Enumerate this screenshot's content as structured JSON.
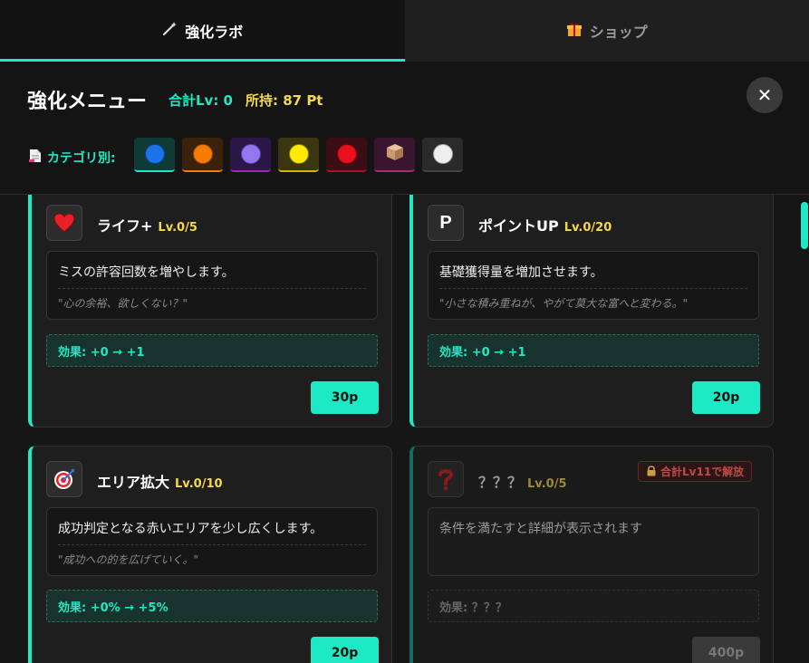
{
  "tabs": [
    {
      "label": "強化ラボ",
      "icon": "wand-icon",
      "active": true
    },
    {
      "label": "ショップ",
      "icon": "gift-icon",
      "active": false
    }
  ],
  "header": {
    "title": "強化メニュー",
    "total_lv": "合計Lv: 0",
    "points": "所持: 87 Pt",
    "close_symbol": "✕"
  },
  "categories": {
    "label": "カテゴリ別:",
    "items": [
      {
        "name": "blue",
        "color": "#1a73e8",
        "bg": "#0e3b36",
        "border": "#1de9c5"
      },
      {
        "name": "orange",
        "color": "#f57c00",
        "bg": "#3a220a",
        "border": "#f57c00"
      },
      {
        "name": "purple",
        "color": "#9575f0",
        "bg": "#2a1647",
        "border": "#9c27b0"
      },
      {
        "name": "yellow",
        "color": "#ffea00",
        "bg": "#3b3512",
        "border": "#d4b800"
      },
      {
        "name": "red",
        "color": "#e8101e",
        "bg": "#3b0d14",
        "border": "#b0102a"
      },
      {
        "name": "box",
        "color": "#d4a373",
        "bg": "#3a1530",
        "border": "#a0306a"
      },
      {
        "name": "white",
        "color": "#eeeeee",
        "bg": "#2a2a2a",
        "border": "#444444"
      }
    ]
  },
  "cards": [
    {
      "icon": "heart-icon",
      "icon_glyph": "❤",
      "name": "ライフ+",
      "lv": "Lv.0/5",
      "desc": "ミスの許容回数を増やします。",
      "flavor": "\"心の余裕、欲しくない？\"",
      "effect": "効果: +0 → +1",
      "cost": "30p",
      "locked": false
    },
    {
      "icon": "p-letter-icon",
      "icon_glyph": "P",
      "name": "ポイントUP",
      "lv": "Lv.0/20",
      "desc": "基礎獲得量を増加させます。",
      "flavor": "\"小さな積み重ねが、やがて莫大な富へと変わる。\"",
      "effect": "効果: +0 → +1",
      "cost": "20p",
      "locked": false
    },
    {
      "icon": "target-icon",
      "icon_glyph": "🎯",
      "name": "エリア拡大",
      "lv": "Lv.0/10",
      "desc": "成功判定となる赤いエリアを少し広くします。",
      "flavor": "\"成功への的を広げていく。\"",
      "effect": "効果: +0% → +5%",
      "cost": "20p",
      "locked": false
    },
    {
      "icon": "question-icon",
      "icon_glyph": "?",
      "name": "？？？",
      "lv": "Lv.0/5",
      "desc": "条件を満たすと詳細が表示されます",
      "flavor": "",
      "effect": "効果: ？？？",
      "cost": "400p",
      "locked": true,
      "lock_text": "合計Lv11で解放"
    }
  ]
}
